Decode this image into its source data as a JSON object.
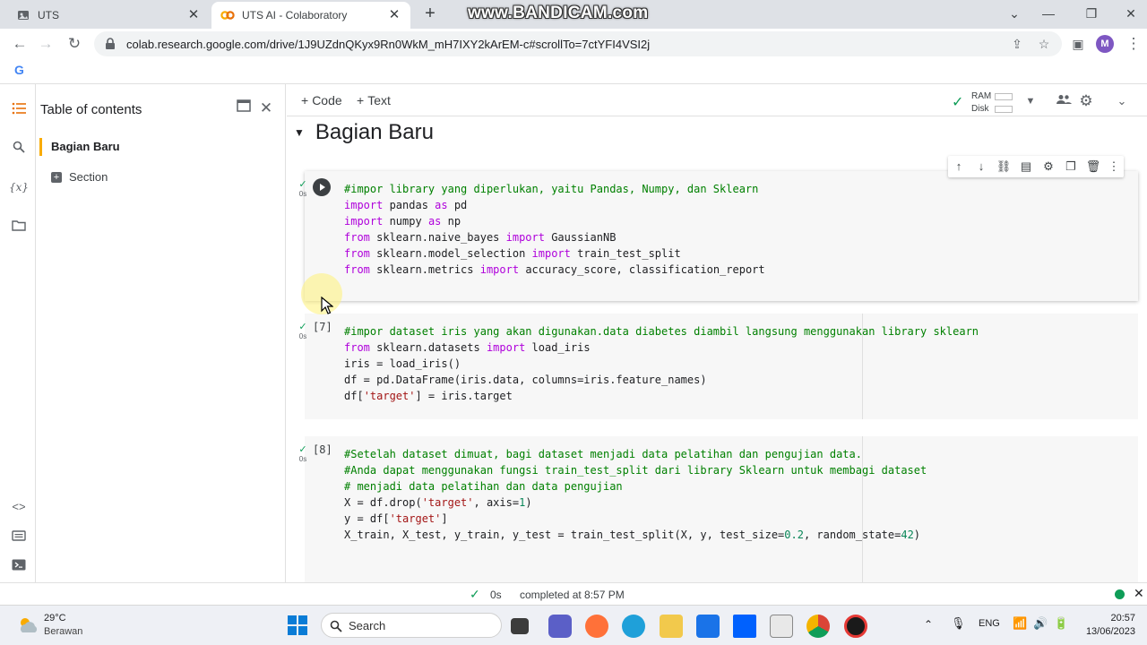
{
  "browser": {
    "tabs": [
      {
        "title": "UTS"
      },
      {
        "title": "UTS AI - Colaboratory"
      }
    ],
    "watermark": "www.BANDICAM.com",
    "url": "colab.research.google.com/drive/1J9UZdnQKyx9Rn0WkM_mH7IXY2kArEM-c#scrollTo=7ctYFI4VSI2j",
    "profile_initial": "M"
  },
  "toc": {
    "title": "Table of contents",
    "items": [
      {
        "label": "Bagian Baru"
      },
      {
        "label": "Section"
      }
    ]
  },
  "notebook_toolbar": {
    "code_label": "Code",
    "text_label": "Text",
    "ram_label": "RAM",
    "disk_label": "Disk"
  },
  "section_title": "Bagian Baru",
  "cells": [
    {
      "exec_count": "",
      "time": "0s",
      "lines": [
        "#impor library yang diperlukan, yaitu Pandas, Numpy, dan Sklearn",
        "import pandas as pd",
        "import numpy as np",
        "from sklearn.naive_bayes import GaussianNB",
        "from sklearn.model_selection import train_test_split",
        "from sklearn.metrics import accuracy_score, classification_report"
      ]
    },
    {
      "exec_count": "[7]",
      "time": "0s",
      "lines": [
        "#impor dataset iris yang akan digunakan.data diabetes diambil langsung menggunakan library sklearn",
        "from sklearn.datasets import load_iris",
        "iris = load_iris()",
        "df = pd.DataFrame(iris.data, columns=iris.feature_names)",
        "df['target'] = iris.target"
      ]
    },
    {
      "exec_count": "[8]",
      "time": "0s",
      "lines": [
        "#Setelah dataset dimuat, bagi dataset menjadi data pelatihan dan pengujian data.",
        "#Anda dapat menggunakan fungsi train_test_split dari library Sklearn untuk membagi dataset",
        "# menjadi data pelatihan dan data pengujian",
        "X = df.drop('target', axis=1)",
        "y = df['target']",
        "X_train, X_test, y_train, y_test = train_test_split(X, y, test_size=0.2, random_state=42)"
      ]
    }
  ],
  "status": {
    "time": "0s",
    "text": "completed at 8:57 PM"
  },
  "taskbar": {
    "temperature": "29°C",
    "condition": "Berawan",
    "search_label": "Search",
    "language": "ENG",
    "time": "20:57",
    "date": "13/06/2023"
  },
  "colors": {
    "keyword": "#af00db",
    "comment": "#008000",
    "string": "#a31515",
    "number": "#098658",
    "colab_accent": "#f9ab00"
  }
}
